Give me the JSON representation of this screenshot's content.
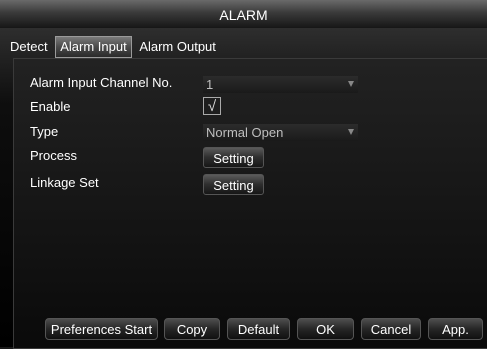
{
  "window": {
    "title": "ALARM"
  },
  "tabs": [
    {
      "label": "Detect",
      "active": false
    },
    {
      "label": "Alarm Input",
      "active": true
    },
    {
      "label": "Alarm Output",
      "active": false
    }
  ],
  "form": {
    "channel": {
      "label": "Alarm Input Channel No.",
      "value": "1"
    },
    "enable": {
      "label": "Enable",
      "checked": true,
      "glyph": "√"
    },
    "type": {
      "label": "Type",
      "value": "Normal Open"
    },
    "process": {
      "label": "Process",
      "button": "Setting"
    },
    "linkage": {
      "label": "Linkage Set",
      "button": "Setting"
    }
  },
  "footer": {
    "preferences": "Preferences Start",
    "copy": "Copy",
    "default": "Default",
    "ok": "OK",
    "cancel": "Cancel",
    "apply": "App."
  }
}
